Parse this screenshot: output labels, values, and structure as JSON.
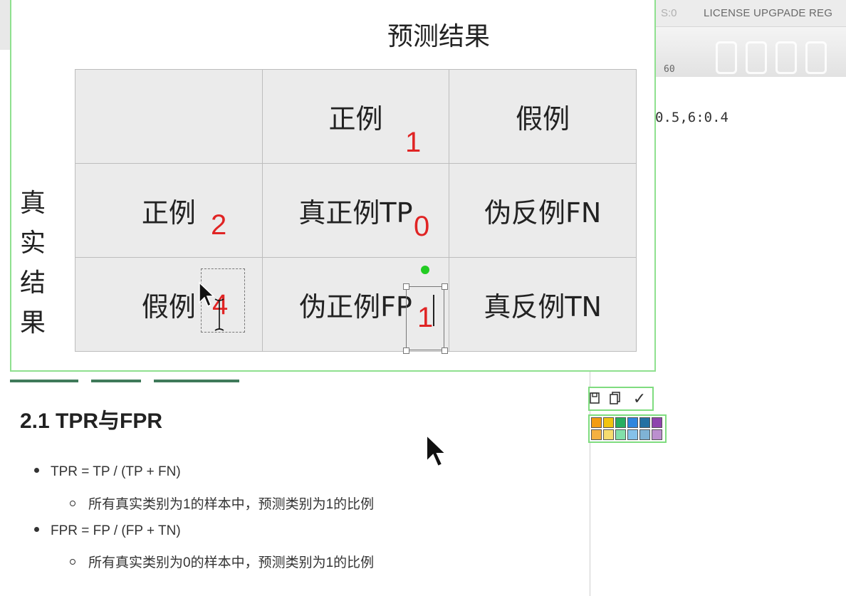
{
  "background": {
    "faded_tab": "S:0",
    "license_text": "LICENSE UPGPADE REG",
    "ruler_tick": "60",
    "code_line": "0.5,6:0.4"
  },
  "slide": {
    "predicted_title": "预测结果",
    "actual_title_chars": [
      "真",
      "实",
      "结",
      "果"
    ],
    "table": {
      "header": [
        "",
        "正例",
        "假例"
      ],
      "rows": [
        {
          "label": "正例",
          "cells": [
            "真正例TP",
            "伪反例FN"
          ]
        },
        {
          "label": "假例",
          "cells": [
            "伪正例FP",
            "真反例TN"
          ]
        }
      ]
    },
    "annotations": {
      "header_positive": "1",
      "row_positive": "2",
      "cell_tp": "0",
      "row_negative": "4",
      "cell_fp": "1"
    },
    "annotation_color": "#e02424"
  },
  "document": {
    "heading": "2.1 TPR与FPR",
    "items": [
      {
        "formula": "TPR = TP / (TP + FN)",
        "desc": "所有真实类别为1的样本中，预测类别为1的比例"
      },
      {
        "formula": "FPR = FP / (FP + TN)",
        "desc": "所有真实类别为0的样本中，预测类别为1的比例"
      }
    ]
  },
  "toolbar": {
    "tools": [
      "save-icon",
      "copy-icon",
      "check-icon"
    ],
    "check_glyph": "✓",
    "accent": "#7fdc7f"
  },
  "palette": {
    "colors": [
      "#f39c12",
      "#f1c40f",
      "#27ae60",
      "#2e86de",
      "#2471a3",
      "#8e44ad",
      "#f5b041",
      "#f7dc6f",
      "#82e0aa",
      "#85c1e9",
      "#7fb3d5",
      "#bb8fce"
    ]
  }
}
